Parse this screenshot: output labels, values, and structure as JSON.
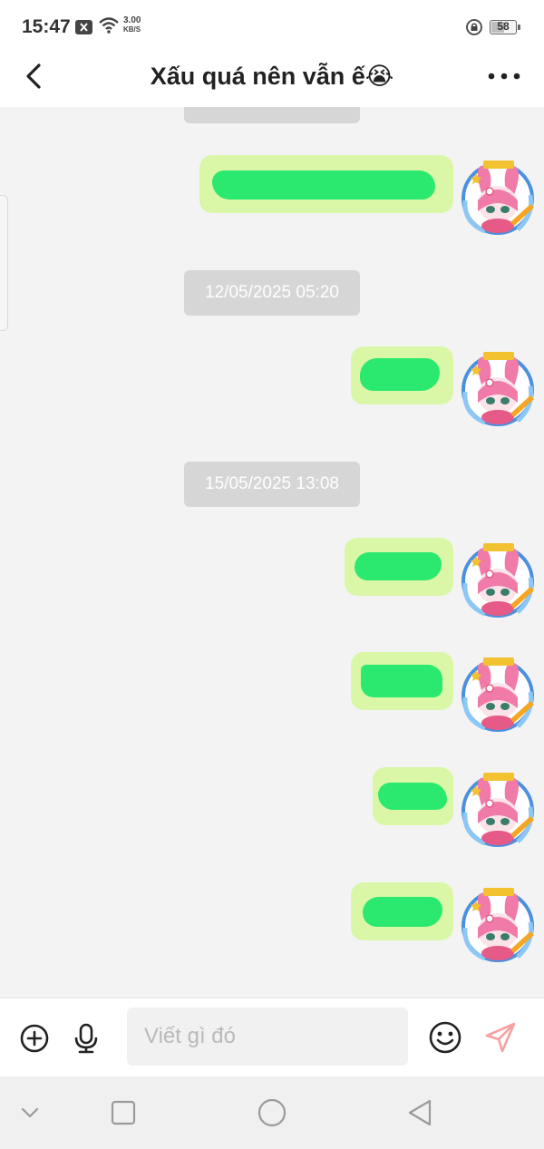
{
  "status_bar": {
    "time": "15:47",
    "net_speed_value": "3.00",
    "net_speed_unit": "KB/S",
    "battery": "58",
    "battery_level": 0.58,
    "icons": [
      "notification-x-icon",
      "wifi-icon",
      "rotation-lock-icon",
      "battery-icon"
    ]
  },
  "header": {
    "title": "Xấu quá nên vẫn ế😭",
    "back_icon": "chevron-left-icon",
    "more_icon": "more-horizontal-icon"
  },
  "conversation": {
    "timestamps": [
      "12/05/2025 05:20",
      "15/05/2025 13:08"
    ],
    "avatar_badge": "WRITER",
    "messages": [
      {
        "sender": "self",
        "content": "redacted"
      },
      {
        "sender": "self",
        "content": "redacted"
      },
      {
        "sender": "self",
        "content": "redacted"
      },
      {
        "sender": "self",
        "content": "redacted"
      },
      {
        "sender": "self",
        "content": "redacted"
      },
      {
        "sender": "self",
        "content": "redacted"
      }
    ]
  },
  "input_bar": {
    "placeholder": "Viết gì đó",
    "icons": [
      "plus-circle-icon",
      "microphone-icon",
      "emoji-icon",
      "send-icon"
    ]
  },
  "nav_bar": {
    "icons": [
      "chevron-down-icon",
      "recent-apps-icon",
      "home-icon",
      "back-triangle-icon"
    ]
  },
  "colors": {
    "bubble": "#d9f7a6",
    "redaction": "#2be86f",
    "timestamp_bg": "#d6d6d6",
    "send_icon": "#f6a0a0"
  }
}
